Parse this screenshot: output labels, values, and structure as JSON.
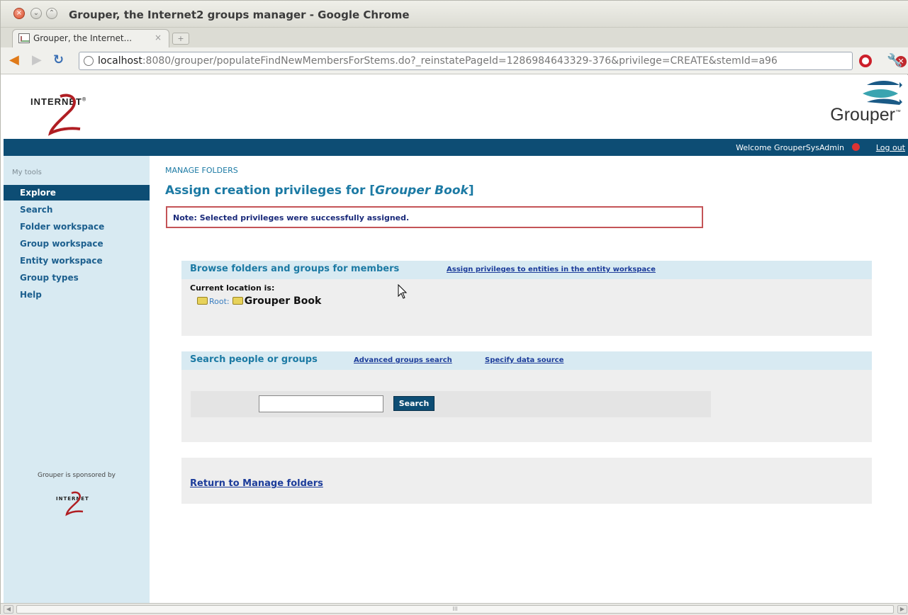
{
  "window": {
    "title": "Grouper, the Internet2 groups manager - Google Chrome"
  },
  "tabs": [
    {
      "label": "Grouper, the Internet...",
      "close": "×"
    }
  ],
  "toolbar": {
    "url_host": "localhost",
    "url_rest": ":8080/grouper/populateFindNewMembersForStems.do?_reinstatePageId=1286984643329-376&privilege=CREATE&stemId=a96",
    "stop_glyph": "✕"
  },
  "header": {
    "logo_text": "INTERNET",
    "logo_trademark": "®",
    "product_name": "Grouper",
    "product_mark": "™",
    "welcome": "Welcome GrouperSysAdmin",
    "logout": "Log out"
  },
  "sidebar": {
    "section_title": "My tools",
    "items": [
      {
        "label": "Explore",
        "active": true
      },
      {
        "label": "Search",
        "active": false
      },
      {
        "label": "Folder workspace",
        "active": false
      },
      {
        "label": "Group workspace",
        "active": false
      },
      {
        "label": "Entity workspace",
        "active": false
      },
      {
        "label": "Group types",
        "active": false
      },
      {
        "label": "Help",
        "active": false
      }
    ],
    "sponsored_text": "Grouper is sponsored by",
    "sponsor_logo_text": "INTERNET"
  },
  "main": {
    "breadcrumb": "MANAGE FOLDERS",
    "title_prefix": "Assign creation privileges for [",
    "title_italic": "Grouper Book",
    "title_suffix": "]",
    "note": "Note: Selected privileges were successfully assigned.",
    "browse_panel": {
      "title": "Browse folders and groups for members",
      "link": "Assign privileges to entities in the entity workspace",
      "current_location_label": "Current location is:",
      "root_label": "Root:",
      "current_folder": "Grouper Book"
    },
    "search_panel": {
      "title": "Search people or groups",
      "advanced_link": "Advanced groups search",
      "data_source_link": "Specify data source",
      "input_value": "",
      "search_button": "Search"
    },
    "return_link": "Return to Manage folders"
  },
  "scrollbar": {
    "grip": "III"
  },
  "colors": {
    "accent_blue": "#0d4d74",
    "link_blue": "#1c7aa4",
    "note_border": "#c45457",
    "sidebar_bg": "#d8eaf2"
  }
}
